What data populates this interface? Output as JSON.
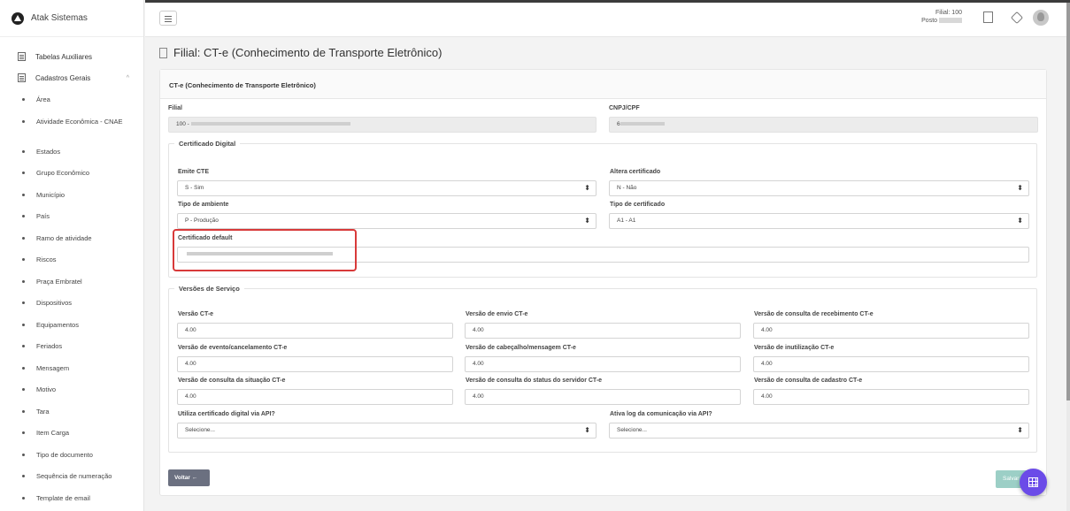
{
  "brand": {
    "name": "Atak Sistemas"
  },
  "sidebar": {
    "groups": [
      {
        "label": "Tabelas Auxiliares"
      },
      {
        "label": "Cadastros Gerais"
      }
    ],
    "items": [
      "Área",
      "Atividade Econômica - CNAE",
      "Estados",
      "Grupo Econômico",
      "Município",
      "País",
      "Ramo de atividade",
      "Riscos",
      "Praça Embratel",
      "Dispositivos",
      "Equipamentos",
      "Feriados",
      "Mensagem",
      "Motivo",
      "Tara",
      "Item Carga",
      "Tipo de documento",
      "Sequência de numeração",
      "Template de email"
    ]
  },
  "topbar": {
    "filial_label": "Filial: 100",
    "posto_label": "Posto"
  },
  "page": {
    "title": "Filial: CT-e (Conhecimento de Transporte Eletrônico)"
  },
  "card": {
    "header": "CT-e (Conhecimento de Transporte Eletrônico)"
  },
  "form": {
    "filial": {
      "label": "Filial",
      "value": "100 - "
    },
    "cnpj": {
      "label": "CNPJ/CPF",
      "value": "6"
    },
    "cert_section": {
      "legend": "Certificado Digital"
    },
    "emite_cte": {
      "label": "Emite CTE",
      "value": "S - Sim"
    },
    "altera_certificado": {
      "label": "Altera certificado",
      "value": "N - Não"
    },
    "tipo_ambiente": {
      "label": "Tipo de ambiente",
      "value": "P - Produção"
    },
    "tipo_certificado": {
      "label": "Tipo de certificado",
      "value": "A1 - A1"
    },
    "certificado_default": {
      "label": "Certificado default"
    },
    "versoes_section": {
      "legend": "Versões de Serviço"
    },
    "versao_cte": {
      "label": "Versão CT-e",
      "value": "4.00"
    },
    "versao_envio": {
      "label": "Versão de envio CT-e",
      "value": "4.00"
    },
    "versao_consulta_recebimento": {
      "label": "Versão de consulta de recebimento CT-e",
      "value": "4.00"
    },
    "versao_evento": {
      "label": "Versão de evento/cancelamento CT-e",
      "value": "4.00"
    },
    "versao_cabecalho": {
      "label": "Versão de cabeçalho/mensagem CT-e",
      "value": "4.00"
    },
    "versao_inutilizacao": {
      "label": "Versão de inutilização CT-e",
      "value": "4.00"
    },
    "versao_consulta_situacao": {
      "label": "Versão de consulta da situação CT-e",
      "value": "4.00"
    },
    "versao_status_servidor": {
      "label": "Versão de consulta do status do servidor CT-e",
      "value": "4.00"
    },
    "versao_cadastro": {
      "label": "Versão de consulta de cadastro CT-e",
      "value": "4.00"
    },
    "certificado_api": {
      "label": "Utiliza certificado digital via API?",
      "value": "Selecione..."
    },
    "log_api": {
      "label": "Ativa log da comunicação via API?",
      "value": "Selecione..."
    }
  },
  "buttons": {
    "voltar": "Voltar ←",
    "salvar": "Salvar"
  }
}
